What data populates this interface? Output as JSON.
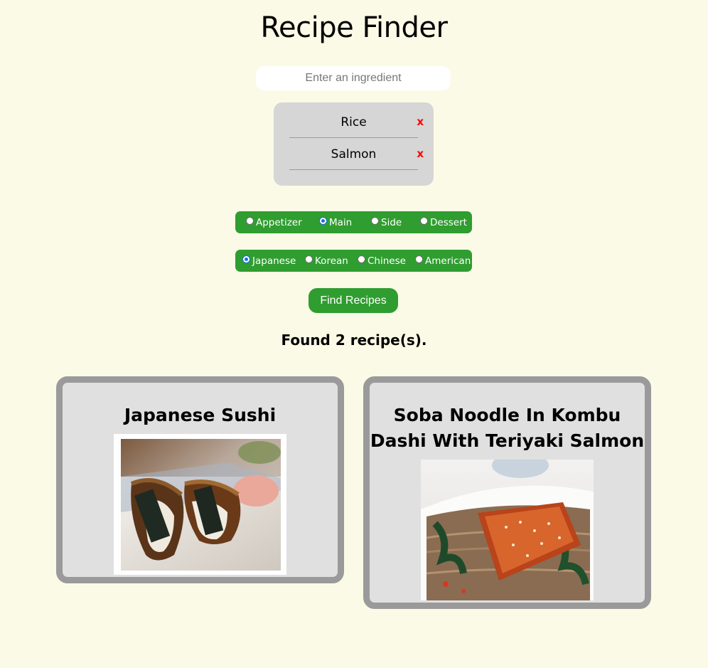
{
  "app": {
    "title": "Recipe Finder"
  },
  "search": {
    "placeholder": "Enter an ingredient",
    "value": ""
  },
  "ingredients": [
    {
      "label": "Rice",
      "remove": "x"
    },
    {
      "label": "Salmon",
      "remove": "x"
    }
  ],
  "course": {
    "options": [
      "Appetizer",
      "Main",
      "Side",
      "Dessert"
    ],
    "selected": "Main"
  },
  "cuisine": {
    "options": [
      "Japanese",
      "Korean",
      "Chinese",
      "American"
    ],
    "selected": "Japanese"
  },
  "actions": {
    "find_label": "Find Recipes"
  },
  "results": {
    "summary": "Found 2 recipe(s).",
    "recipes": [
      {
        "title": "Japanese Sushi",
        "image": "sushi-photo"
      },
      {
        "title": "Soba Noodle In Kombu Dashi With Teriyaki Salmon",
        "image": "soba-salmon-photo"
      }
    ]
  },
  "colors": {
    "background": "#fafae6",
    "accent_green": "#2f9d2f",
    "card_border": "#9a9a9a",
    "card_bg": "#e0e0e0",
    "remove_red": "#ff0000"
  }
}
